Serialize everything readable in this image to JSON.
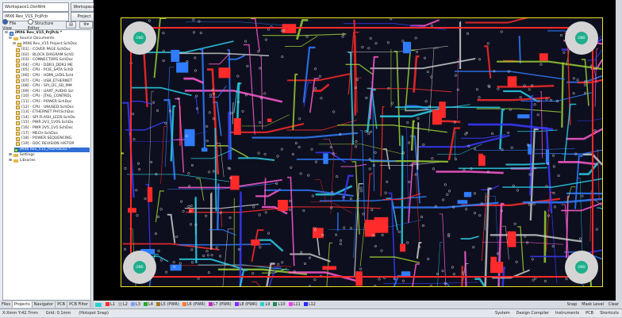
{
  "workspace": {
    "value": "Workspace1.DsnWrk",
    "button": "Workspace"
  },
  "project": {
    "value": "iMX6 Rev_V1S_PcjPcb",
    "button": "Project"
  },
  "view_modes": {
    "file_view": "File View",
    "structure_editor": "Structure Editor"
  },
  "tree": {
    "root": "iMX6 Rev_V15_PrjPcb *",
    "source_folder": "Source Documents",
    "project_sch": "iMX6 Rev_V15 Project.SchDoc",
    "docs": [
      "[01] - COVER PAGE.SchDoc",
      "[02] - BLOCK DIAGRAM.SchD",
      "[03] - CONNECTORS.SchDoc",
      "[04] - CPU - DDR3_DDR3 ME",
      "[05] - CPU - PCIE_SATA SchD",
      "[06] - CPU - HDMI_LVDS.SchI",
      "[07] - CPU - USB_ETHERNET",
      "[08] - CPU - SPI_I2C_SD_MM",
      "[09] - CPU - UART_AUDIO Scl",
      "[10] - CPU - JTAG_CONTROL",
      "[11] - CPU - POWER.SchDoc",
      "[12] - CPU - UNUSED.SchDoc",
      "[13] - ETHERNET PHY.SchDoc",
      "[14] - SPI FLASH_LEDS.SchDo",
      "[15] - PWR 2V3_1V0S.SchDo",
      "[16] - PWR 2V5_1V5.SchDoc",
      "[17] - MECH.SchDoc",
      "[18] - POWER SEQUENCING.",
      "[19] - DOC REVISION HISTOR"
    ],
    "pcb_doc": "iMX6 Rev_V15_PcbPcbDoc *",
    "settings": "Settings",
    "libraries": "Libraries"
  },
  "panel_tabs": [
    "Files",
    "Projects",
    "Navigator",
    "PCB",
    "PCB Filter"
  ],
  "layer_tabs": [
    {
      "label": "L1",
      "color": "#ff2a2a"
    },
    {
      "label": "L2",
      "color": "#b8b8b8"
    },
    {
      "label": "L3",
      "color": "#7fa0ff"
    },
    {
      "label": "L4",
      "color": "#2aaa2a"
    },
    {
      "label": "L5 (PWR)",
      "color": "#a87a2a"
    },
    {
      "label": "L6 (PWR)",
      "color": "#ff7a2a"
    },
    {
      "label": "L7 (PWR)",
      "color": "#c02ac0"
    },
    {
      "label": "L8 (PWR)",
      "color": "#8a2aff"
    },
    {
      "label": "L9",
      "color": "#2ad0d0"
    },
    {
      "label": "L10",
      "color": "#1a8a5a"
    },
    {
      "label": "L11",
      "color": "#ff3aff"
    },
    {
      "label": "L12",
      "color": "#2a2aff"
    }
  ],
  "right_toolbar": [
    "Snap",
    "Mask Level",
    "Clear"
  ],
  "status": {
    "coords": "X:Xmm Y:42.7mm",
    "grid": "Grid: 0.1mm",
    "snap": "(Hotspot Snap)"
  },
  "status_right": [
    "System",
    "Design Compiler",
    "Instruments",
    "PCB",
    "Shortcuts"
  ],
  "gnd_label": "GND"
}
